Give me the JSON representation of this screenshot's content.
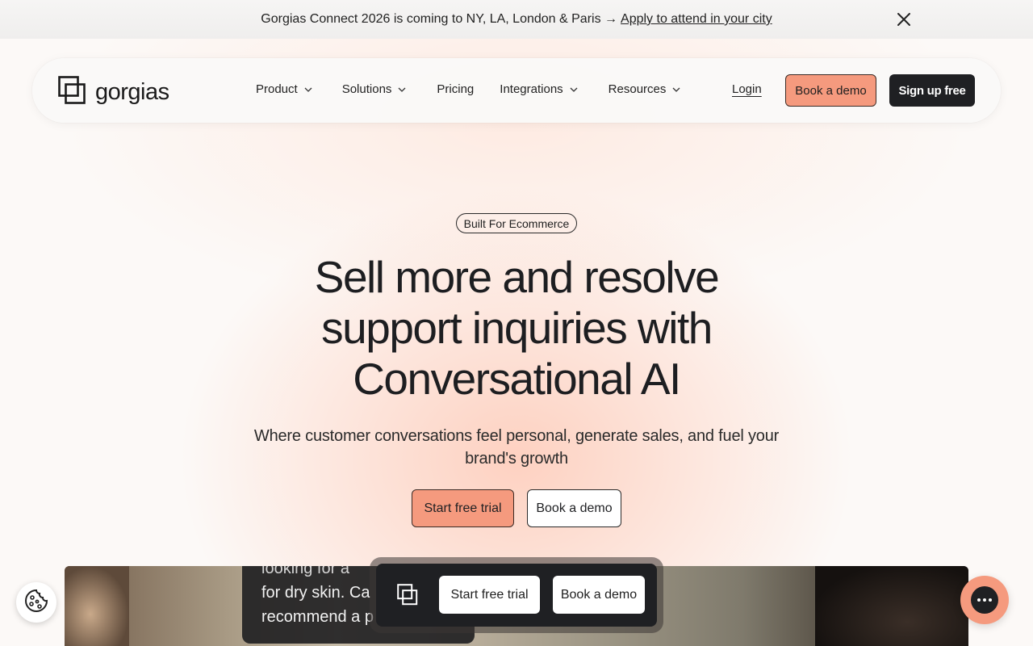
{
  "announcement": {
    "text": "Gorgias Connect 2026 is coming to NY, LA, London & Paris →",
    "link": "Apply to attend in your city",
    "close_icon": "close-icon"
  },
  "nav": {
    "brand": "gorgias",
    "logo_icon": "gorgias-logo-icon",
    "menu": [
      {
        "label": "Product",
        "has_dropdown": true
      },
      {
        "label": "Solutions",
        "has_dropdown": true
      },
      {
        "label": "Pricing",
        "has_dropdown": false
      },
      {
        "label": "Integrations",
        "has_dropdown": true
      },
      {
        "label": "Resources",
        "has_dropdown": true
      }
    ],
    "login": "Login",
    "book_demo": "Book a demo",
    "sign_up": "Sign up free"
  },
  "hero": {
    "badge": "Built For Ecommerce",
    "headline_line1": "Sell more and resolve",
    "headline_line2": "support inquiries with",
    "headline_line3": "Conversational AI",
    "subhead": "Where customer conversations feel personal, generate sales, and fuel your brand's growth",
    "cta_trial": "Start free trial",
    "cta_demo": "Book a demo"
  },
  "video": {
    "bubble_line1": "looking for a",
    "bubble_line2": "for dry skin. Ca",
    "bubble_line3": "recommend a p"
  },
  "floating_bar": {
    "trial": "Start free trial",
    "demo": "Book a demo"
  },
  "widgets": {
    "cookie_icon": "cookie-icon",
    "chat_icon": "chat-icon"
  },
  "colors": {
    "accent": "#f59a7e",
    "dark": "#1f2023",
    "background": "#fcf9f7"
  }
}
